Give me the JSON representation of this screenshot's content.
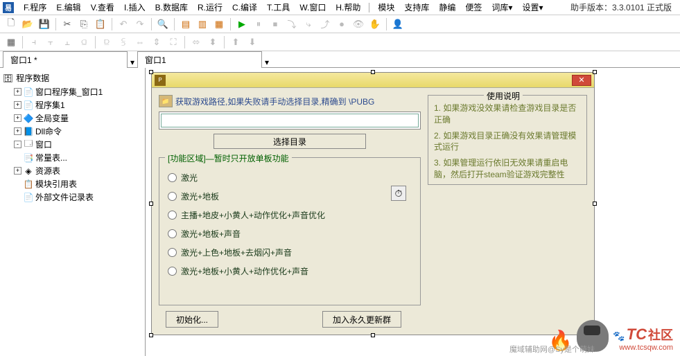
{
  "app_icon_text": "易",
  "menu": {
    "program": "F.程序",
    "edit": "E.编辑",
    "view": "V.查看",
    "insert": "I.插入",
    "database": "B.数据库",
    "run": "R.运行",
    "compile": "C.编译",
    "tools": "T.工具",
    "window": "W.窗口",
    "help": "H.帮助",
    "module": "模块",
    "support_lib": "支持库",
    "static": "静编",
    "notes": "便签",
    "vocab": "词库",
    "settings": "设置"
  },
  "version_label": "助手版本：3.3.0101 正式版",
  "tabs": {
    "tab1": "窗口1 *",
    "tab2": "窗口1"
  },
  "tree": {
    "root": "程序数据",
    "items": [
      {
        "label": "窗口程序集_窗口1",
        "exp": "+",
        "icon": "📄"
      },
      {
        "label": "程序集1",
        "exp": "+",
        "icon": "📄"
      },
      {
        "label": "全局变量",
        "exp": "+",
        "icon": "🔷"
      },
      {
        "label": "Dll命令",
        "exp": "+",
        "icon": "📘"
      },
      {
        "label": "窗口",
        "exp": "-",
        "icon": "🗔"
      },
      {
        "label": "常量表...",
        "exp": "",
        "icon": "📑",
        "indent": false
      },
      {
        "label": "资源表",
        "exp": "+",
        "icon": "◈"
      },
      {
        "label": "模块引用表",
        "exp": "",
        "icon": "📋"
      },
      {
        "label": "外部文件记录表",
        "exp": "",
        "icon": "📄"
      }
    ]
  },
  "form": {
    "path_hint": "获取游戏路径,如果失败请手动选择目录,精确到 \\PUBG",
    "path_value": "",
    "select_dir": "选择目录",
    "group_title": "[功能区域]—暂时只开放单板功能",
    "radios": [
      "激光",
      "激光+地板",
      "主播+地皮+小黄人+动作优化+声音优化",
      "激光+地板+声音",
      "激光+上色+地板+去烟闪+声音",
      "激光+地板+小黄人+动作优化+声音"
    ],
    "init_btn": "初始化...",
    "join_btn": "加入永久更新群",
    "usage_title": "使用说明",
    "usage_lines": [
      "1. 如果游戏没效果请检查游戏目录是否正确",
      "2. 如果游戏目录正确没有效果请管理模式运行",
      "3. 如果管理运行依旧无效果请重启电脑，然后打开steam验证游戏完整性"
    ]
  },
  "watermark": {
    "brand": "TC",
    "suffix": "社区",
    "url": "www.tcsqw.com",
    "note": "魔域辅助网@Sy是个萌妹."
  }
}
